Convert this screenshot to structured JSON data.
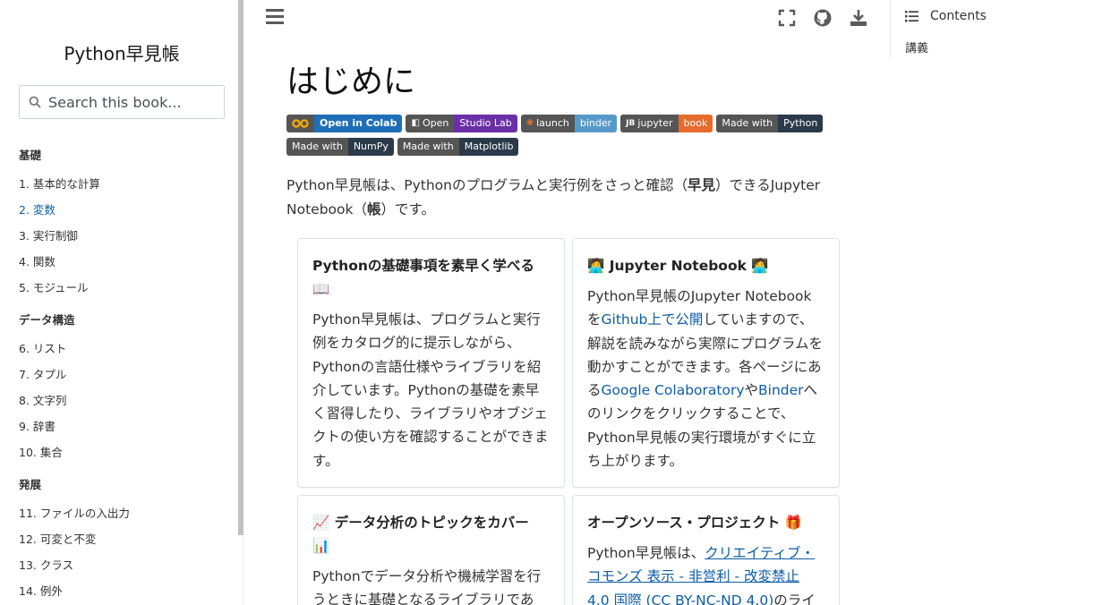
{
  "sidebar": {
    "brand": "Python早見帳",
    "search_placeholder": "Search this book...",
    "captions": [
      "基礎",
      "データ構造",
      "発展"
    ],
    "items": [
      "1. 基本的な計算",
      "2. 変数",
      "3. 実行制御",
      "4. 関数",
      "5. モジュール",
      "6. リスト",
      "7. タプル",
      "8. 文字列",
      "9. 辞書",
      "10. 集合",
      "11. ファイルの入出力",
      "12. 可変と不変",
      "13. クラス",
      "14. 例外"
    ],
    "active_index": 1
  },
  "topbar": {
    "icons": [
      "menu-icon",
      "fullscreen-icon",
      "github-icon",
      "download-icon"
    ]
  },
  "toc": {
    "heading": "Contents",
    "item": "講義"
  },
  "main": {
    "title": "はじめに",
    "badges": [
      {
        "left": "Open in Colab",
        "right": "",
        "color": "#1f6fb8"
      },
      {
        "left": "Open",
        "right": "Studio Lab",
        "color": "#6b2fa8"
      },
      {
        "left": "launch",
        "right": "binder",
        "color": "#579aca"
      },
      {
        "left": "jupyter",
        "right": "book",
        "color": "#e66b2c"
      },
      {
        "left": "Made with",
        "right": "Python",
        "color": "#2b3a4a"
      },
      {
        "left": "Made with",
        "right": "NumPy",
        "color": "#2b3a4a"
      },
      {
        "left": "Made with",
        "right": "Matplotlib",
        "color": "#2b3a4a"
      }
    ],
    "intro": {
      "p1": "Python早見帳は、Pythonのプログラムと実行例をさっと確認（",
      "b1": "早見",
      "p2": "）できるJupyter Notebook（",
      "b2": "帳",
      "p3": "）です。"
    },
    "cards": {
      "card1": {
        "title": "Pythonの基礎事項を素早く学べる 📖",
        "body": "Python早見帳は、プログラムと実行例をカタログ的に提示しながら、Pythonの言語仕様やライブラリを紹介しています。Pythonの基礎を素早く習得したり、ライブラリやオブジェクトの使い方を確認することができます。"
      },
      "card2": {
        "title": "🧑‍💻 Jupyter Notebook 🧑‍💻",
        "b1": "Python早見帳のJupyter Notebookを",
        "l1": "Github上で公開",
        "b2": "していますので、解説を読みながら実際にプログラムを動かすことができます。各ページにある",
        "l2": "Google Colaboratory",
        "b3": "や",
        "l3": "Binder",
        "b4": "へのリンクをクリックすることで、Python早見帳の実行環境がすぐに立ち上がります。"
      },
      "card3": {
        "title": "📈 データ分析のトピックをカバー 📊",
        "body": "Pythonでデータ分析や機械学習を行うときに基礎となるライブラリであ"
      },
      "card4": {
        "title": "オープンソース・プロジェクト 🎁",
        "b1": "Python早見帳は、",
        "l1": "クリエイティブ・コモンズ 表示 - 非営利 - 改変禁止 4.0 国際 (CC BY-NC-ND 4.0)",
        "b2": "のライ"
      }
    }
  }
}
